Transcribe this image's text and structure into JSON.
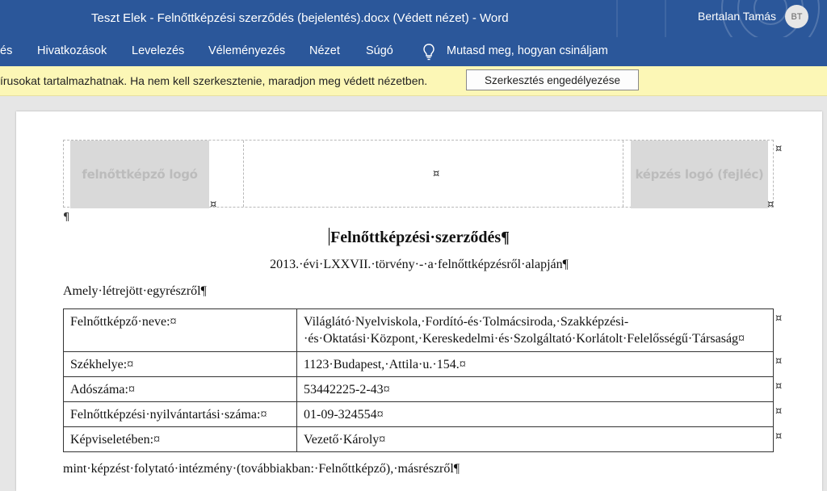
{
  "window": {
    "title": "Teszt Elek - Felnőttképzési szerződés (bejelentés).docx (Védett nézet)  -  Word",
    "user_name": "Bertalan Tamás",
    "user_initials": "BT"
  },
  "ribbon": {
    "tabs": [
      "és",
      "Hivatkozások",
      "Levelezés",
      "Véleményezés",
      "Nézet",
      "Súgó"
    ],
    "tell_me": "Mutasd meg, hogyan csináljam"
  },
  "protected_view": {
    "message": "írusokat tartalmazhatnak. Ha nem kell szerkesztenie, maradjon meg védett nézetben.",
    "enable_button": "Szerkesztés engedélyezése"
  },
  "header": {
    "left_logo": "felnőttképző logó",
    "right_logo": "képzés logó (fejléc)",
    "cell_mark": "¤",
    "pilcrow": "¶"
  },
  "document": {
    "title": "Felnőttképzési·szerződés¶",
    "subtitle": "2013.·évi·LXXVII.·törvény·-·a·felnőttképzésről·alapján¶",
    "intro": "Amely·létrejött·egyrészről¶",
    "rows": [
      {
        "label": "Felnőttképző·neve:¤",
        "value": "Világlátó·Nyelviskola,·Fordító-és·Tolmácsiroda,·Szakképzési-·és·Oktatási·Központ,·Kereskedelmi·és·Szolgáltató·Korlátolt·Felelősségű·Társaság¤"
      },
      {
        "label": "Székhelye:¤",
        "value": "1123·Budapest,·Attila·u.·154.¤"
      },
      {
        "label": "Adószáma:¤",
        "value": "53442225-2-43¤"
      },
      {
        "label": "Felnőttképzési·nyilvántartási·száma:¤",
        "value": "01-09-324554¤"
      },
      {
        "label": "Képviseletében:¤",
        "value": "Vezető·Károly¤"
      }
    ],
    "closing": "mint·képzést·folytató·intézmény·(továbbiakban:·Felnőttképző),·másrészről¶"
  },
  "icons": {
    "tell_me": "lightbulb-icon"
  },
  "colors": {
    "ribbon": "#2b579a",
    "message_bar": "#fcf7b6",
    "logo_placeholder": "#d9d9d9"
  }
}
